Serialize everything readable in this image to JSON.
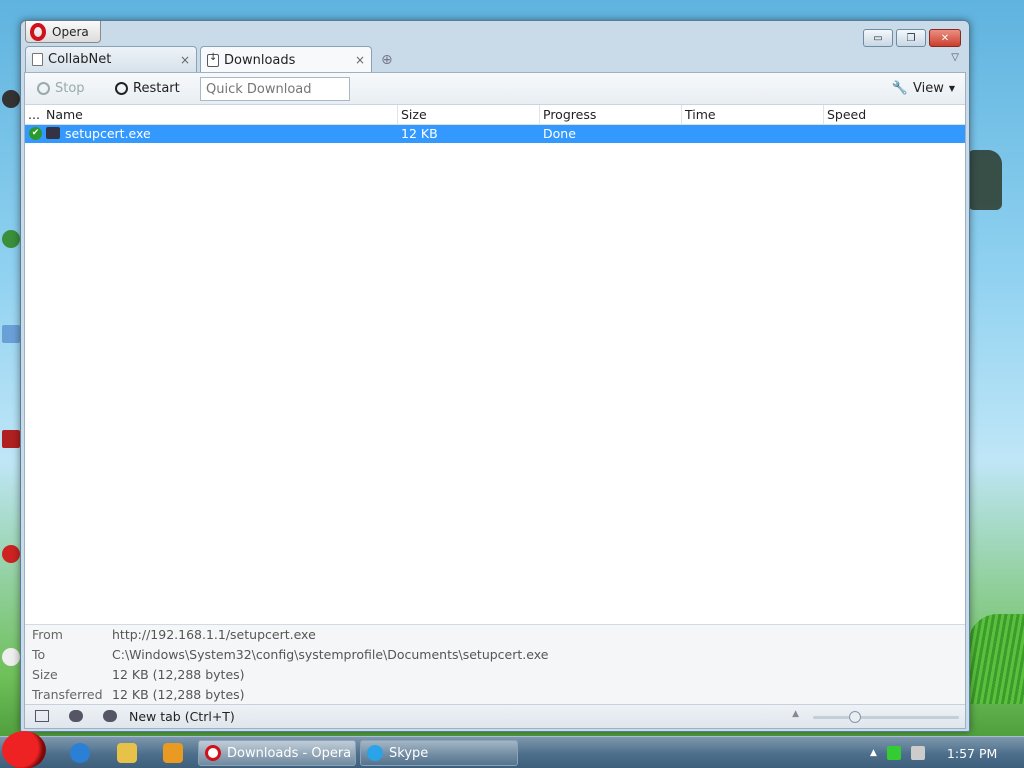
{
  "window": {
    "app_button": "Opera",
    "controls": {
      "minimize": "▭",
      "restore": "❐",
      "close": "✕"
    }
  },
  "tabs": [
    {
      "label": "CollabNet",
      "close": "×"
    },
    {
      "label": "Downloads",
      "close": "×"
    }
  ],
  "toolbar": {
    "stop_label": "Stop",
    "restart_label": "Restart",
    "quick_download_placeholder": "Quick Download",
    "view_label": "View"
  },
  "columns": {
    "dots": "...",
    "name": "Name",
    "size": "Size",
    "progress": "Progress",
    "time": "Time",
    "speed": "Speed"
  },
  "downloads": [
    {
      "name": "setupcert.exe",
      "size": "12 KB",
      "progress": "Done",
      "time": "",
      "speed": ""
    }
  ],
  "details": {
    "from_label": "From",
    "from_value": "http://192.168.1.1/setupcert.exe",
    "to_label": "To",
    "to_value": "C:\\Windows\\System32\\config\\systemprofile\\Documents\\setupcert.exe",
    "size_label": "Size",
    "size_value": "12 KB (12,288 bytes)",
    "transferred_label": "Transferred",
    "transferred_value": "12 KB (12,288 bytes)"
  },
  "statusbar": {
    "newtab_label": "New tab (Ctrl+T)"
  },
  "taskbar": {
    "items": [
      {
        "label": "Downloads - Opera"
      },
      {
        "label": "Skype"
      }
    ],
    "clock": "1:57 PM"
  },
  "colors": {
    "selection": "#3399ff",
    "opera_red": "#d0101b"
  }
}
